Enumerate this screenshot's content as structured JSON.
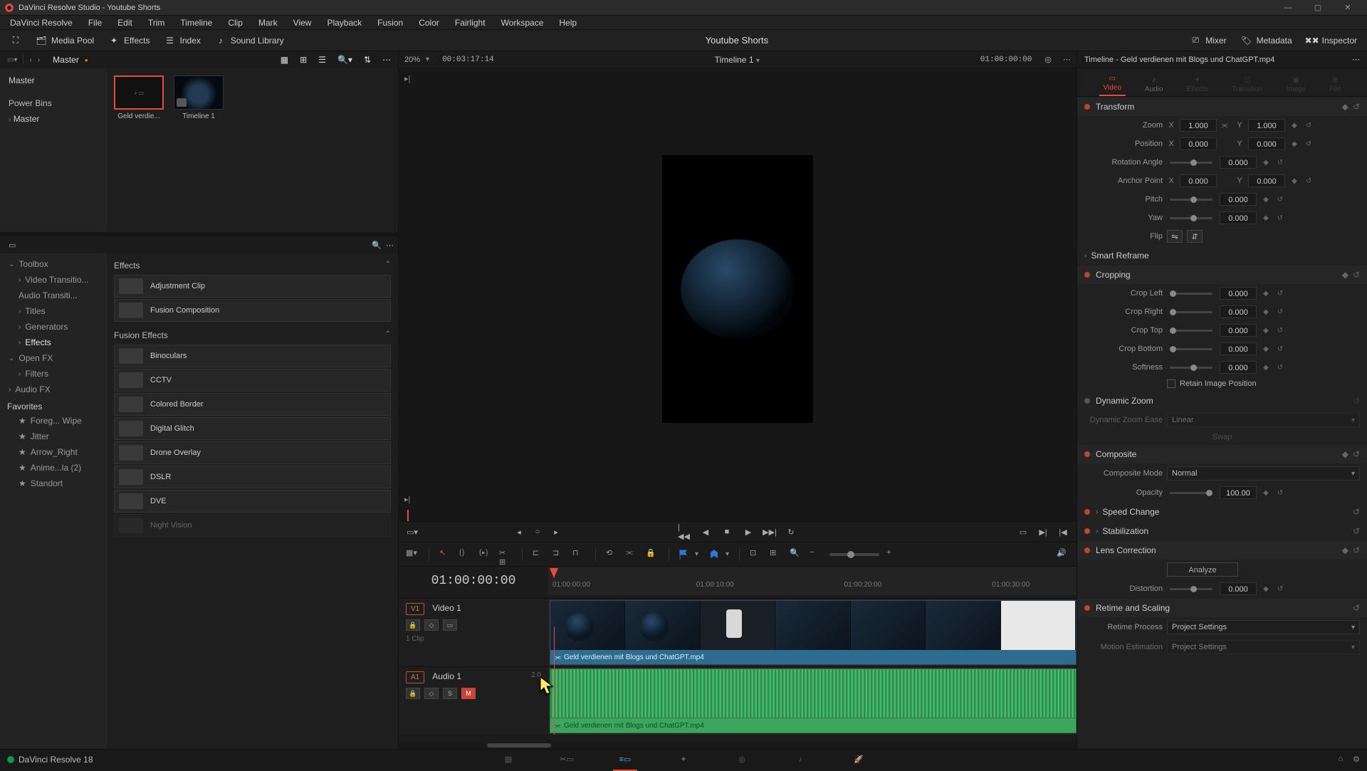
{
  "titlebar": {
    "title": "DaVinci Resolve Studio - Youtube Shorts"
  },
  "menubar": [
    "DaVinci Resolve",
    "File",
    "Edit",
    "Trim",
    "Timeline",
    "Clip",
    "Mark",
    "View",
    "Playback",
    "Fusion",
    "Color",
    "Fairlight",
    "Workspace",
    "Help"
  ],
  "upper_toolbar": {
    "media_pool": "Media Pool",
    "effects": "Effects",
    "index": "Index",
    "sound_library": "Sound Library",
    "project_title": "Youtube Shorts",
    "mixer": "Mixer",
    "metadata": "Metadata",
    "inspector": "Inspector"
  },
  "bin": {
    "header": "Master",
    "tree_root": "Master",
    "section2": "Power Bins",
    "tree_pb": "Master",
    "clips": [
      "Geld verdie...",
      "Timeline 1"
    ]
  },
  "fx_tree": {
    "toolbox": "Toolbox",
    "items": [
      "Video Transitio...",
      "Audio Transiti...",
      "Titles",
      "Generators",
      "Effects"
    ],
    "open_fx": "Open FX",
    "filters": "Filters",
    "audio_fx": "Audio FX",
    "favorites": "Favorites",
    "fav_items": [
      "Foreg... Wipe",
      "Jitter",
      "Arrow_Right",
      "Anime...la (2)",
      "Standort"
    ]
  },
  "fx_list": {
    "group1": "Effects",
    "g1": [
      "Adjustment Clip",
      "Fusion Composition"
    ],
    "group2": "Fusion Effects",
    "g2": [
      "Binoculars",
      "CCTV",
      "Colored Border",
      "Digital Glitch",
      "Drone Overlay",
      "DSLR",
      "DVE",
      "Night Vision"
    ]
  },
  "viewer": {
    "zoom": "20%",
    "src_tc": "00:03:17:14",
    "timeline_name": "Timeline 1",
    "rec_tc": "01:00:00:00"
  },
  "timeline": {
    "tc": "01:00:00:00",
    "ticks": [
      "01:00:00:00",
      "01:00:10:00",
      "01:00:20:00",
      "01:00:30:00"
    ],
    "v1_badge": "V1",
    "v1_name": "Video 1",
    "v1_info": "1 Clip",
    "a1_badge": "A1",
    "a1_name": "Audio 1",
    "a1_meta": "2.0",
    "clip_label": "Geld verdienen mit Blogs und ChatGPT.mp4",
    "solo": "S",
    "mute": "M"
  },
  "inspector": {
    "title": "Timeline - Geld verdienen mit Blogs und ChatGPT.mp4",
    "tabs": [
      "Video",
      "Audio",
      "Effects",
      "Transition",
      "Image",
      "File"
    ],
    "transform": "Transform",
    "zoom": "Zoom",
    "zoom_x": "1.000",
    "zoom_y": "1.000",
    "position": "Position",
    "pos_x": "0.000",
    "pos_y": "0.000",
    "rotation": "Rotation Angle",
    "rot_v": "0.000",
    "anchor": "Anchor Point",
    "anc_x": "0.000",
    "anc_y": "0.000",
    "pitch": "Pitch",
    "pitch_v": "0.000",
    "yaw": "Yaw",
    "yaw_v": "0.000",
    "flip": "Flip",
    "smart_reframe": "Smart Reframe",
    "cropping": "Cropping",
    "crop_left": "Crop Left",
    "crop_left_v": "0.000",
    "crop_right": "Crop Right",
    "crop_right_v": "0.000",
    "crop_top": "Crop Top",
    "crop_top_v": "0.000",
    "crop_bottom": "Crop Bottom",
    "crop_bottom_v": "0.000",
    "softness": "Softness",
    "softness_v": "0.000",
    "retain": "Retain Image Position",
    "dynamic_zoom": "Dynamic Zoom",
    "dz_ease": "Dynamic Zoom Ease",
    "dz_ease_v": "Linear",
    "swap": "Swap",
    "composite": "Composite",
    "comp_mode": "Composite Mode",
    "comp_mode_v": "Normal",
    "opacity": "Opacity",
    "opacity_v": "100.00",
    "speed_change": "Speed Change",
    "stabilization": "Stabilization",
    "lens": "Lens Correction",
    "analyze": "Analyze",
    "distortion": "Distortion",
    "distortion_v": "0.000",
    "retime": "Retime and Scaling",
    "retime_proc": "Retime Process",
    "retime_proc_v": "Project Settings",
    "motion_est": "Motion Estimation",
    "motion_est_v": "Project Settings",
    "x": "X",
    "y": "Y"
  },
  "footer": {
    "version": "DaVinci Resolve 18"
  }
}
